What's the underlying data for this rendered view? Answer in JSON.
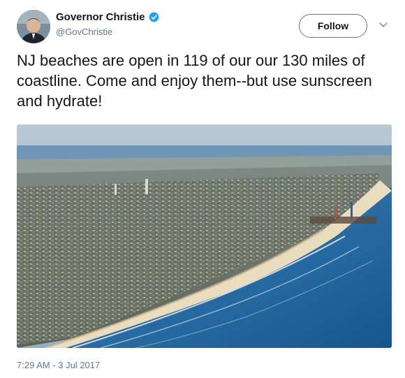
{
  "author": {
    "display_name": "Governor Christie",
    "handle": "@GovChristie",
    "verified": true,
    "avatar_icon": "avatar"
  },
  "actions": {
    "follow_label": "Follow",
    "menu_icon": "chevron-down-icon"
  },
  "tweet": {
    "text": "NJ beaches are open in 119 of our our 130 miles of coastline. Come and enjoy them--but use sunscreen and hydrate!",
    "timestamp": "7:29 AM - 3 Jul 2017"
  },
  "colors": {
    "verified_badge": "#1da1f2",
    "secondary_text": "#657786",
    "ocean": "#1f6fa8",
    "sand": "#e8dcc0"
  }
}
